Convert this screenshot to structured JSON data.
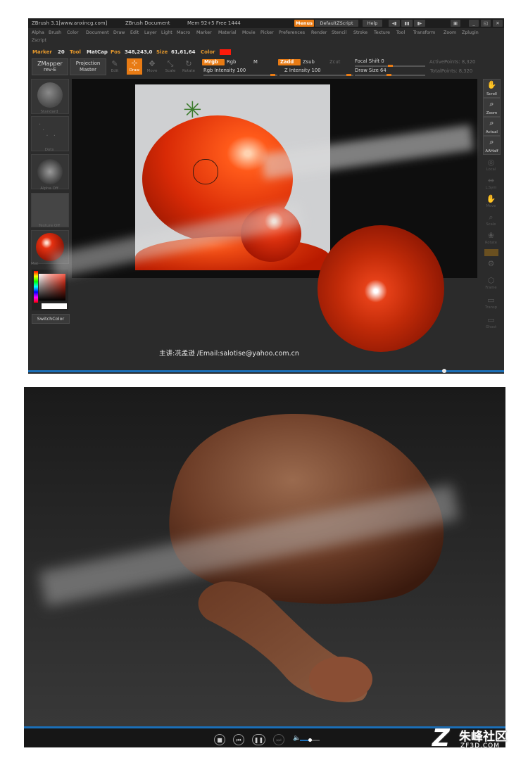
{
  "zbrush": {
    "title": {
      "app": "ZBrush  3.1[www.anxincg.com]",
      "document": "ZBrush Document",
      "mem": "Mem 92+5 Free 1444",
      "menus_btn": "Menus",
      "script_btn": "DefaultZScript",
      "help_btn": "Help"
    },
    "menu_items": [
      "Alpha",
      "Brush",
      "Color",
      "Document",
      "Draw",
      "Edit",
      "Layer",
      "Light",
      "Macro",
      "Marker",
      "Material",
      "Movie",
      "Picker",
      "Preferences",
      "Render",
      "Stencil",
      "Stroke",
      "Texture",
      "Tool",
      "Transform",
      "Zoom",
      "Zplugin"
    ],
    "zscript_label": "Zscript",
    "status": {
      "marker_label": "Marker",
      "marker_value": "20",
      "tool_label": "Tool",
      "tool_value": "MatCap",
      "pos_label": "Pos",
      "pos_value": "348,243,0",
      "size_label": "Size",
      "size_value": "61,61,64",
      "color_label": "Color",
      "color_swatch": "#ff1a0a"
    },
    "toolbar": {
      "zmapper_line1": "ZMapper",
      "zmapper_line2": "rev-E",
      "projection_line1": "Projection",
      "projection_line2": "Master",
      "edit": "Edit",
      "draw": "Draw",
      "move": "Move",
      "scale": "Scale",
      "rotate": "Rotate",
      "mrgb": "Mrgb",
      "rgb": "Rgb",
      "m": "M",
      "rgb_intensity": "Rgb Intensity 100",
      "zadd": "Zadd",
      "zsub": "Zsub",
      "zcut": "Zcut",
      "z_intensity": "Z Intensity 100",
      "focal_shift": "Focal Shift 0",
      "draw_size": "Draw Size 64",
      "active_points": "ActivePoints: 8,320",
      "total_points": "TotalPoints: 8,320"
    },
    "left_shelf": {
      "standard": "Standard",
      "dots": "Dots",
      "alpha_off": "Alpha Off",
      "texture_off": "Texture Off",
      "material": "Mat",
      "switch_color": "SwitchColor"
    },
    "right_shelf": [
      {
        "label": "Scroll",
        "icon": "hand-icon"
      },
      {
        "label": "Zoom",
        "icon": "magnifier-icon"
      },
      {
        "label": "Actual",
        "icon": "magnifier-icon"
      },
      {
        "label": "AAHalf",
        "icon": "magnifier-icon"
      },
      {
        "label": "Local",
        "icon": "local-icon"
      },
      {
        "label": "L.Sym",
        "icon": "symmetry-icon"
      },
      {
        "label": "Move",
        "icon": "move-icon"
      },
      {
        "label": "Scale",
        "icon": "scale-icon"
      },
      {
        "label": "Rotate",
        "icon": "rotate-icon"
      },
      {
        "label": "Frame",
        "icon": "frame-icon"
      },
      {
        "label": "Transp",
        "icon": "transparency-icon"
      },
      {
        "label": "Ghost",
        "icon": "ghost-icon"
      }
    ],
    "credit": "主讲:冼孟逊 /Email:salotise@yahoo.com.cn"
  },
  "viewer": {
    "controls": [
      "stop-icon",
      "previous-icon",
      "pause-icon",
      "next-icon",
      "volume-icon"
    ],
    "volume_level": 0.5
  },
  "watermark": {
    "logo_letter": "Z",
    "name_cn": "朱峰社区",
    "name_en": "ZF3D.COM"
  }
}
